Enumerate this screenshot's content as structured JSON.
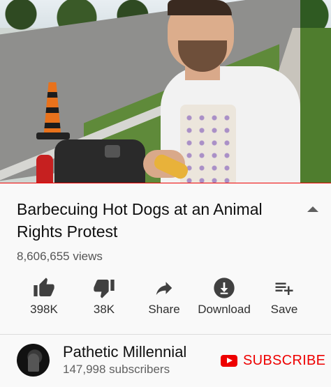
{
  "video": {
    "progress_fraction": 1.0,
    "accent_color": "#ee0000"
  },
  "title": "Barbecuing Hot Dogs at an Animal Rights Protest",
  "views": "8,606,655 views",
  "actions": {
    "like": {
      "icon": "thumbs-up-icon",
      "label": "398K"
    },
    "dislike": {
      "icon": "thumbs-down-icon",
      "label": "38K"
    },
    "share": {
      "icon": "share-arrow-icon",
      "label": "Share"
    },
    "download": {
      "icon": "download-icon",
      "label": "Download"
    },
    "save": {
      "icon": "playlist-add-icon",
      "label": "Save"
    }
  },
  "channel": {
    "name": "Pathetic Millennial",
    "subscribers": "147,998 subscribers"
  },
  "subscribe": {
    "label": "SUBSCRIBE",
    "color": "#ee0000"
  }
}
